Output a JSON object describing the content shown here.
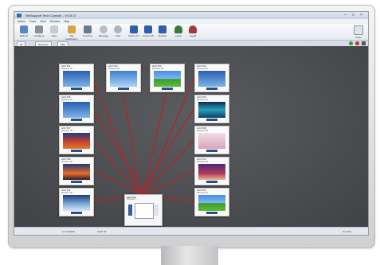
{
  "window": {
    "title": "NetSupport Tech Console - V4.00.3"
  },
  "menu": [
    "Admin",
    "Tools",
    "View",
    "Window",
    "Help"
  ],
  "toolbar": {
    "buttons": [
      "Refresh",
      "Configure",
      "Files",
      "File Distribution",
      "Inventory",
      "Message",
      "Chat",
      "Power On",
      "Power Off",
      "Restart",
      "Logon",
      "Logoff"
    ],
    "right_button": "Close"
  },
  "tabs": [
    "All",
    "Overview",
    "Map"
  ],
  "clients": [
    {
      "name": "ACCT01",
      "sub": "Windows XP",
      "wallpaper": "blue"
    },
    {
      "name": "ACCT02",
      "sub": "Windows XP",
      "wallpaper": "fish"
    },
    {
      "name": "ACCT03",
      "sub": "Windows XP",
      "wallpaper": "xp"
    },
    {
      "name": "ACCT04",
      "sub": "Windows XP",
      "wallpaper": "blue"
    },
    {
      "name": "ACCT05",
      "sub": "Windows XP",
      "wallpaper": "blue"
    },
    {
      "name": "ACCT06",
      "sub": "Windows XP",
      "wallpaper": "aurora"
    },
    {
      "name": "ACCT07",
      "sub": "Windows XP",
      "wallpaper": "red"
    },
    {
      "name": "ACCT08",
      "sub": "Windows XP",
      "wallpaper": "pink"
    },
    {
      "name": "ACCT09",
      "sub": "Windows XP",
      "wallpaper": "sunset"
    },
    {
      "name": "ACCT10",
      "sub": "Windows XP",
      "wallpaper": "purple"
    },
    {
      "name": "ACCT11",
      "sub": "Windows XP",
      "wallpaper": "snow"
    },
    {
      "name": "ACCT12",
      "sub": "Windows XP",
      "wallpaper": "xp"
    }
  ],
  "server": {
    "name": "ACCT00",
    "sub": "Windows 7"
  },
  "status": {
    "left": "12 Available",
    "middle": "Clear All",
    "right": "Console"
  },
  "colors": {
    "link": "#b0272a",
    "canvas": "#4a4c4f"
  }
}
